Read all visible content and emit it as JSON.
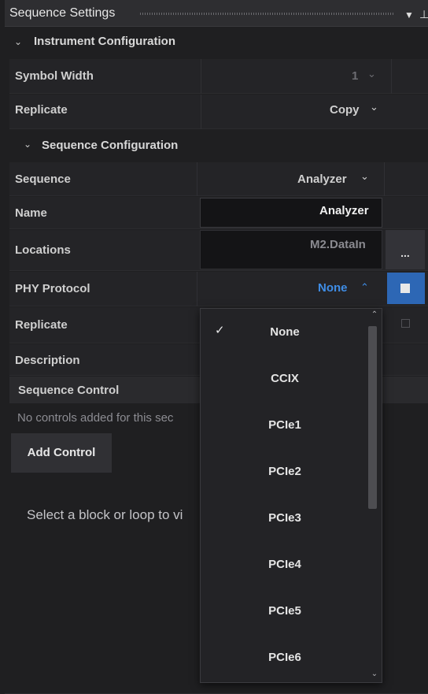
{
  "panel": {
    "title": "Sequence Settings",
    "pin_icon": "pin-icon",
    "menu_icon": "dropdown-arrow-icon"
  },
  "instrument_config": {
    "header": "Instrument Configuration",
    "rows": {
      "symbol_width": {
        "label": "Symbol Width",
        "value": "1"
      },
      "replicate": {
        "label": "Replicate",
        "value": "Copy"
      }
    }
  },
  "sequence_config": {
    "header": "Sequence Configuration",
    "rows": {
      "sequence": {
        "label": "Sequence",
        "value": "Analyzer"
      },
      "name": {
        "label": "Name",
        "value": "Analyzer"
      },
      "locations": {
        "label": "Locations",
        "value": "M2.DataIn",
        "button": "..."
      },
      "phy_protocol": {
        "label": "PHY Protocol",
        "value": "None"
      },
      "replicate": {
        "label": "Replicate"
      },
      "description": {
        "label": "Description"
      }
    }
  },
  "sequence_control": {
    "header": "Sequence Control",
    "empty_text": "No controls added for this sec",
    "add_button": "Add Control"
  },
  "hint": "Select a block or loop to vi",
  "dropdown": {
    "selected": "None",
    "options": [
      "None",
      "CCIX",
      "PCIe1",
      "PCIe2",
      "PCIe3",
      "PCIe4",
      "PCIe5",
      "PCIe6"
    ]
  },
  "colors": {
    "accent": "#2d67b5",
    "link": "#3f8de6",
    "background": "#1f1f21"
  }
}
